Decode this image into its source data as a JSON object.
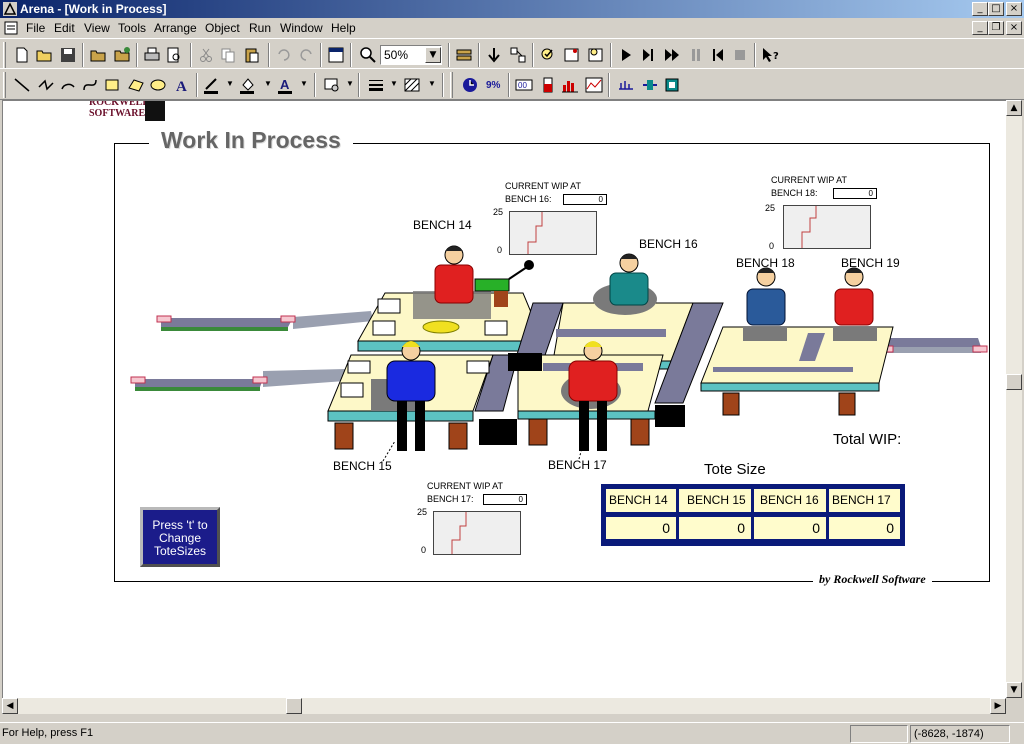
{
  "window": {
    "title": "Arena - [Work in Process]"
  },
  "menu": [
    "File",
    "Edit",
    "View",
    "Tools",
    "Arrange",
    "Object",
    "Run",
    "Window",
    "Help"
  ],
  "toolbar": {
    "zoom": "50%"
  },
  "canvas": {
    "logo_line1": "ROCKWELL",
    "logo_line2": "SOFTWARE",
    "title": "Work In Process",
    "credit": "by Rockwell Software",
    "total_wip_label": "Total WIP:",
    "tote_size_label": "Tote Size",
    "press_button": [
      "Press 't' to",
      "Change",
      "ToteSizes"
    ],
    "benches": {
      "b14": "BENCH 14",
      "b15": "BENCH 15",
      "b16": "BENCH 16",
      "b17": "BENCH 17",
      "b18": "BENCH 18",
      "b19": "BENCH 19"
    },
    "wip_plots": [
      {
        "heading": "CURRENT WIP AT",
        "bench_label": "BENCH 16:",
        "value": "0",
        "max": "25",
        "min": "0"
      },
      {
        "heading": "CURRENT WIP AT",
        "bench_label": "BENCH 18:",
        "value": "0",
        "max": "25",
        "min": "0"
      },
      {
        "heading": "CURRENT WIP AT",
        "bench_label": "BENCH 17:",
        "value": "0",
        "max": "25",
        "min": "0"
      }
    ],
    "tote_table": {
      "headers": [
        "BENCH 14",
        "BENCH 15",
        "BENCH 16",
        "BENCH 17"
      ],
      "values": [
        "0",
        "0",
        "0",
        "0"
      ]
    }
  },
  "status": {
    "help": "For Help, press F1",
    "coords": "(-8628, -1874)"
  },
  "colors": {
    "title_bar": "#0a246a",
    "table_bg": "#0a1a7a",
    "cell_bg": "#fffccc",
    "button_bg": "#1b1c8a"
  }
}
